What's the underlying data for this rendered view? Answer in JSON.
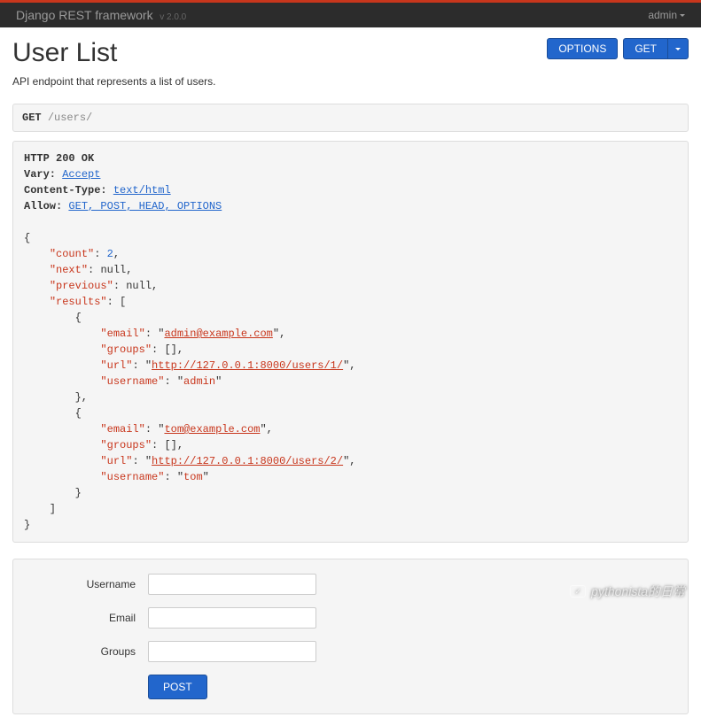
{
  "navbar": {
    "brand": "Django REST framework",
    "version": "v 2.0.0",
    "user": "admin"
  },
  "page": {
    "title": "User List",
    "description": "API endpoint that represents a list of users."
  },
  "buttons": {
    "options": "OPTIONS",
    "get": "GET"
  },
  "request": {
    "method": "GET",
    "path": "/users/"
  },
  "response": {
    "status_line": "HTTP 200 OK",
    "headers": {
      "vary_label": "Vary:",
      "vary_value": "Accept",
      "ctype_label": "Content-Type:",
      "ctype_value": "text/html",
      "allow_label": "Allow:",
      "allow_value": "GET, POST, HEAD, OPTIONS"
    },
    "body": {
      "count": 2,
      "next": "null",
      "previous": "null",
      "results": [
        {
          "email": "admin@example.com",
          "groups": "[]",
          "url": "http://127.0.0.1:8000/users/1/",
          "username": "admin"
        },
        {
          "email": "tom@example.com",
          "groups": "[]",
          "url": "http://127.0.0.1:8000/users/2/",
          "username": "tom"
        }
      ]
    }
  },
  "form": {
    "username_label": "Username",
    "email_label": "Email",
    "groups_label": "Groups",
    "submit": "POST"
  },
  "watermark": {
    "text": "pythonista的日常"
  }
}
